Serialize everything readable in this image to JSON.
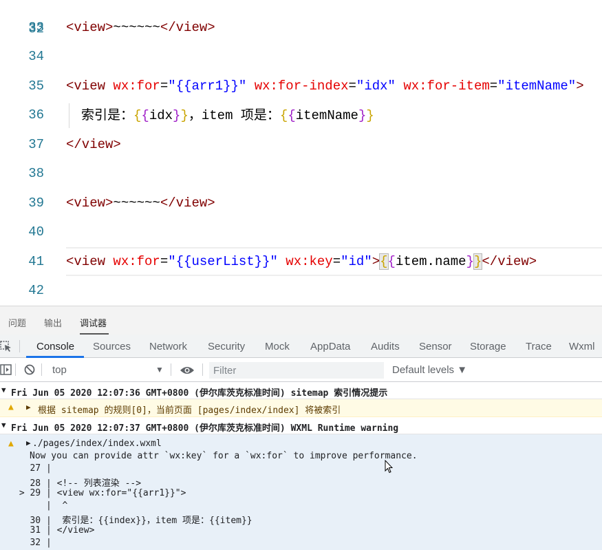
{
  "editor": {
    "partial_line_number": "32",
    "lines": [
      {
        "num": "33",
        "segments": [
          [
            "tag",
            "<view>"
          ],
          [
            "txt",
            "~~~~~~"
          ],
          [
            "tag",
            "</view>"
          ]
        ]
      },
      {
        "num": "34",
        "segments": []
      },
      {
        "num": "35",
        "segments": [
          [
            "tag",
            "<view "
          ],
          [
            "attr",
            "wx:for"
          ],
          [
            "txt",
            "="
          ],
          [
            "str",
            "\"{{arr1}}\""
          ],
          [
            "txt",
            " "
          ],
          [
            "attr",
            "wx:for-index"
          ],
          [
            "txt",
            "="
          ],
          [
            "str",
            "\"idx\""
          ],
          [
            "txt",
            " "
          ],
          [
            "attr",
            "wx:for-item"
          ],
          [
            "txt",
            "="
          ],
          [
            "str",
            "\"itemName\""
          ],
          [
            "tag",
            ">"
          ]
        ]
      },
      {
        "num": "36",
        "indent": true,
        "segments": [
          [
            "cn",
            "索引是："
          ],
          [
            "b1",
            "{"
          ],
          [
            "b2",
            "{"
          ],
          [
            "txt",
            "idx"
          ],
          [
            "b2",
            "}"
          ],
          [
            "b1",
            "}"
          ],
          [
            "cn",
            "，"
          ],
          [
            "txt",
            "item "
          ],
          [
            "cn",
            "项是："
          ],
          [
            "b1",
            "{"
          ],
          [
            "b2",
            "{"
          ],
          [
            "txt",
            "itemName"
          ],
          [
            "b2",
            "}"
          ],
          [
            "b1",
            "}"
          ]
        ]
      },
      {
        "num": "37",
        "segments": [
          [
            "tag",
            "</view>"
          ]
        ]
      },
      {
        "num": "38",
        "segments": []
      },
      {
        "num": "39",
        "segments": [
          [
            "tag",
            "<view>"
          ],
          [
            "txt",
            "~~~~~~"
          ],
          [
            "tag",
            "</view>"
          ]
        ]
      },
      {
        "num": "40",
        "segments": []
      },
      {
        "num": "41",
        "segments": [
          [
            "tag",
            "<view "
          ],
          [
            "attr",
            "wx:for"
          ],
          [
            "txt",
            "="
          ],
          [
            "str",
            "\"{{userList}}\""
          ],
          [
            "txt",
            " "
          ],
          [
            "attr",
            "wx:key"
          ],
          [
            "txt",
            "="
          ],
          [
            "str",
            "\"id\""
          ],
          [
            "tag",
            ">"
          ],
          [
            "b1bm",
            "{"
          ],
          [
            "b2",
            "{"
          ],
          [
            "txt",
            "item.name"
          ],
          [
            "b2",
            "}"
          ],
          [
            "b1bm",
            "}"
          ],
          [
            "tag",
            "</view>"
          ]
        ]
      },
      {
        "num": "42",
        "segments": []
      }
    ]
  },
  "panel_tabs": [
    "问题",
    "输出",
    "调试器"
  ],
  "devtools_tabs": [
    "Console",
    "Sources",
    "Network",
    "Security",
    "Mock",
    "AppData",
    "Audits",
    "Sensor",
    "Storage",
    "Trace",
    "Wxml"
  ],
  "console_toolbar": {
    "context": "top",
    "filter_placeholder": "Filter",
    "levels": "Default levels ▼"
  },
  "messages": {
    "group1_header": "Fri Jun 05 2020 12:07:36 GMT+0800 (伊尔库茨克标准时间) sitemap 索引情况提示",
    "group1_warning": "根据 sitemap 的规则[0]，当前页面 [pages/index/index] 将被索引",
    "group2_header": "Fri Jun 05 2020 12:07:37 GMT+0800 (伊尔库茨克标准时间) WXML Runtime warning",
    "group2_file": "./pages/index/index.wxml",
    "group2_note": "Now you can provide attr `wx:key` for a `wx:for` to improve performance.",
    "snippet": [
      {
        "prefix": "   27 | ",
        "text": ""
      },
      {
        "prefix": "   28 | ",
        "text": "<!-- 列表渲染 -->"
      },
      {
        "prefix": " > 29 | ",
        "text": "<view wx:for=\"{{arr1}}\">"
      },
      {
        "prefix": "      | ",
        "text": " ^"
      },
      {
        "prefix": "   30 | ",
        "text": " 索引是：{{index}}，item 项是：{{item}}"
      },
      {
        "prefix": "   31 | ",
        "text": "</view>"
      },
      {
        "prefix": "   32 | ",
        "text": ""
      }
    ]
  },
  "colors": {
    "accent": "#1a73e8",
    "warn_bg": "#fffbe5",
    "selected_bg": "#e8f0f8"
  }
}
